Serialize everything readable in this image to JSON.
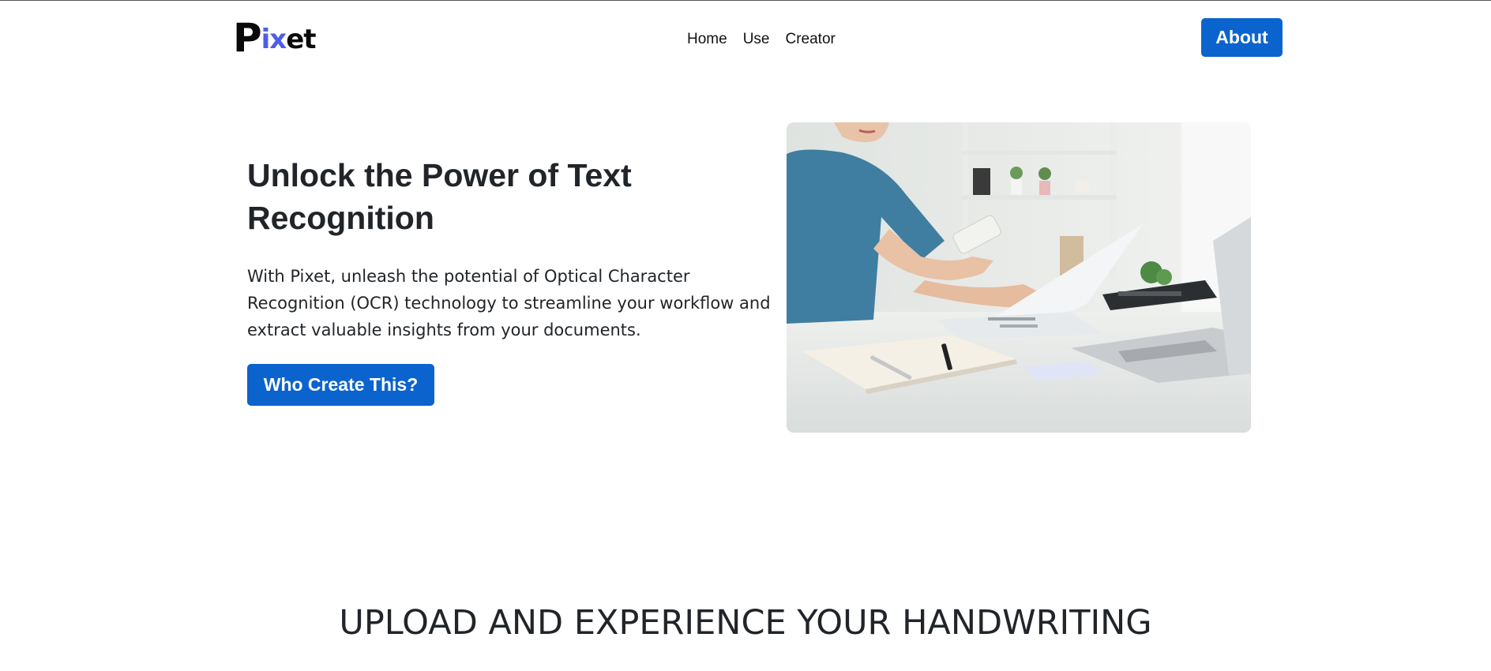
{
  "brand": {
    "logo_first": "P",
    "logo_accent": "ix",
    "logo_last": "et",
    "accent_color": "#4f5de8"
  },
  "nav": {
    "links": [
      {
        "label": "Home"
      },
      {
        "label": "Use"
      },
      {
        "label": "Creator"
      }
    ],
    "about_label": "About"
  },
  "hero": {
    "title": "Unlock the Power of Text Recognition",
    "description": "With Pixet, unleash the potential of Optical Character Recognition (OCR) technology to streamline your workflow and extract valuable insights from your documents.",
    "cta_label": "Who Create This?",
    "image_subject": "woman-reading-document-with-phone-at-desk"
  },
  "upload": {
    "heading": "UPLOAD AND EXPERIENCE YOUR HANDWRITING"
  },
  "colors": {
    "primary_button": "#0b63ce",
    "text": "#212529",
    "background": "#ffffff"
  }
}
